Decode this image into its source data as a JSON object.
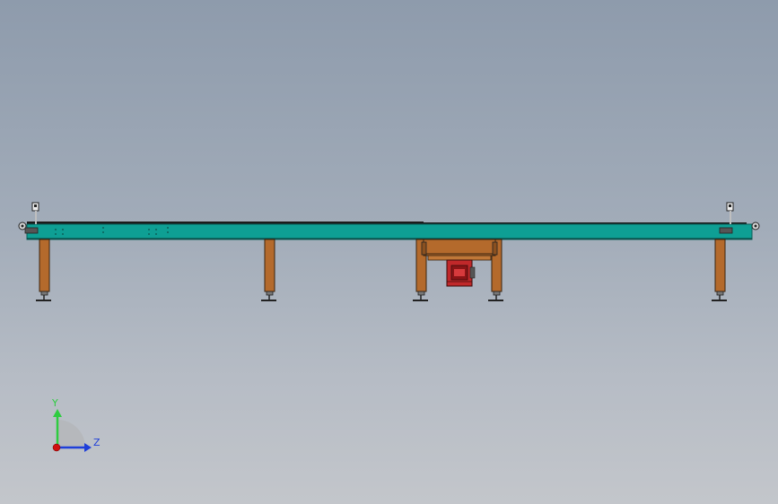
{
  "triad": {
    "y_label": "Y",
    "z_label": "Z",
    "y_color": "#2ecc40",
    "z_color": "#1f3fd9",
    "x_color": "#d01010"
  },
  "model": {
    "belt_color": "#0e9f94",
    "frame_color": "#b46a2c",
    "motor_color": "#c0282a",
    "background_top": "#8e9bac",
    "background_bottom": "#c3c6cb"
  }
}
